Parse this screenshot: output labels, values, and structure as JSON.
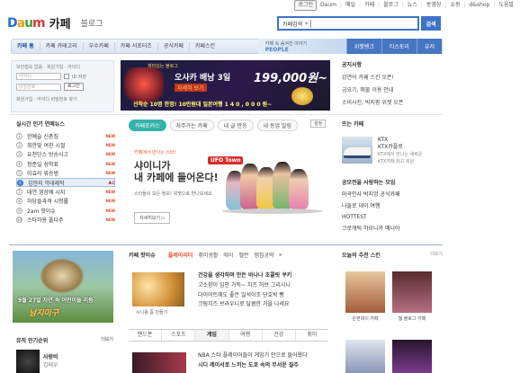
{
  "util": {
    "links": [
      "로그인",
      "Daum",
      "메일",
      "카페",
      "블로그",
      "뉴스",
      "동영상",
      "쇼핑",
      "d&shop",
      "도움말"
    ]
  },
  "header": {
    "logo_text": "Daum",
    "service": "카페",
    "blog_link": "블로그",
    "search_scope": "카페검색",
    "search_button": "검색"
  },
  "nav": {
    "items": [
      "카페 홈",
      "카페 카테고리",
      "우수카페",
      "카페 서포터즈",
      "공식카페",
      "카페스킨"
    ],
    "people_line1": "카페 속 숨겨진 이야기",
    "people_line2": "PEOPLE",
    "right_buttons": [
      "위젯뱅크",
      "티스토리",
      "유저"
    ]
  },
  "login": {
    "hint": "보안접속 없음 · 회원가입 · 아이디",
    "id_placeholder": "아이디",
    "pw_placeholder": "비밀번호",
    "save_label": "ID 저장",
    "login_button": "로그인",
    "bottom": "회원가입 · 아이디 비밀번호 찾기"
  },
  "banner": {
    "tag": "재미있는 블로그",
    "title": "오사카 배낭 3일",
    "sub": "자세히 보기",
    "price": "199,000원~",
    "promo": "선착순 10명 한정! 10만원대 일본여행 1 4 0 , 0 0 0 원~"
  },
  "notice": {
    "title": "공지사항",
    "items": [
      "강연어 카페 스킨 오픈!",
      "금요기, 매물 이용 안내",
      "소비사진, 빅지팡 위젯 오픈"
    ]
  },
  "ranking": {
    "title": "실시간 인기 연예뉴스",
    "items": [
      {
        "num": "1",
        "text": "한예슬 신촌집",
        "new": "NEW"
      },
      {
        "num": "2",
        "text": "최한빛 여친 시절",
        "new": "NEW"
      },
      {
        "num": "3",
        "text": "유천딘스 방송사고",
        "new": "NEW"
      },
      {
        "num": "4",
        "text": "정준일 성학표",
        "new": "NEW"
      },
      {
        "num": "5",
        "text": "이효리 류승범",
        "new": "NEW"
      },
      {
        "num": "6",
        "text": "김현지 악대제작",
        "new": "2"
      },
      {
        "num": "7",
        "text": "태연 영상에 시지",
        "new": "NEW"
      },
      {
        "num": "8",
        "text": "하당들과격 시청률",
        "new": "NEW"
      },
      {
        "num": "9",
        "text": "2am 핫이슈",
        "new": "NEW"
      },
      {
        "num": "10",
        "text": "스타하용 플다주",
        "new": "NEW"
      }
    ]
  },
  "center": {
    "tabs": [
      "카페포커스",
      "자주가는 카페",
      "내 글 반응",
      "내 동업 알림"
    ],
    "settings": "설정",
    "feature_kicker": "카페에서 만나는 스타!",
    "feature_title_1": "샤이니가",
    "feature_title_2": "내 카페에 들어온다!",
    "feature_desc": "스타들의 모든 정보! 위젯으로 만나보세요",
    "feature_logo": "UFO Town",
    "feature_button": "자세히보기 ▷"
  },
  "rightcol": {
    "title": "뜨는 카페",
    "ktx_title": "KTX",
    "ktx_line1": "KTX카플로",
    "ktx_line2": "KTX에서 만나는 새로운",
    "ktx_line3": "KTX카페 최고 회원",
    "list_title": "공모전을 사랑하는 모임",
    "items": [
      "마곡인사 박지엉 공식카페",
      "나들로 데이 여행",
      "HOTTEST",
      "크로캐틱 하모니카 매니아"
    ]
  },
  "promo": {
    "date": "9월 27일 자연 속 어린이들 리듬",
    "title": "남지미구"
  },
  "music": {
    "title": "뮤직 인기순위",
    "more": "더보기",
    "song": "사랑비",
    "artist": "김태우"
  },
  "hot": {
    "title": "카페 핫이슈",
    "tabs": [
      "플레이리더",
      "취미생활",
      "에이",
      "밸런",
      "맵집공략"
    ],
    "food_caption": "시니용 좀 만들기",
    "items": [
      "건강을 생각하며 만든 바나나 초콜릿 쿠키",
      "고소함이 입안 가득~ 치즈 허브 그리시니",
      "다이어트에도 좋은 일석이조 단호박 빵",
      "크림치즈 브라우니로 달콤한 가을 나세요"
    ],
    "subtabs": [
      "핸드폰",
      "스포츠",
      "게임",
      "여행",
      "건강",
      "취미"
    ],
    "game_items": [
      "NBA 스타 플레이어들이 게임기 안으로 들어왔다",
      "시디 레이서로 느끼는 도쿄 속의 무서운 질주"
    ]
  },
  "skin": {
    "title": "오늘의 추천 스킨",
    "more": "더보기",
    "captions": [
      "온편데이 카페",
      "웹 블로그 카페",
      "",
      ""
    ]
  }
}
